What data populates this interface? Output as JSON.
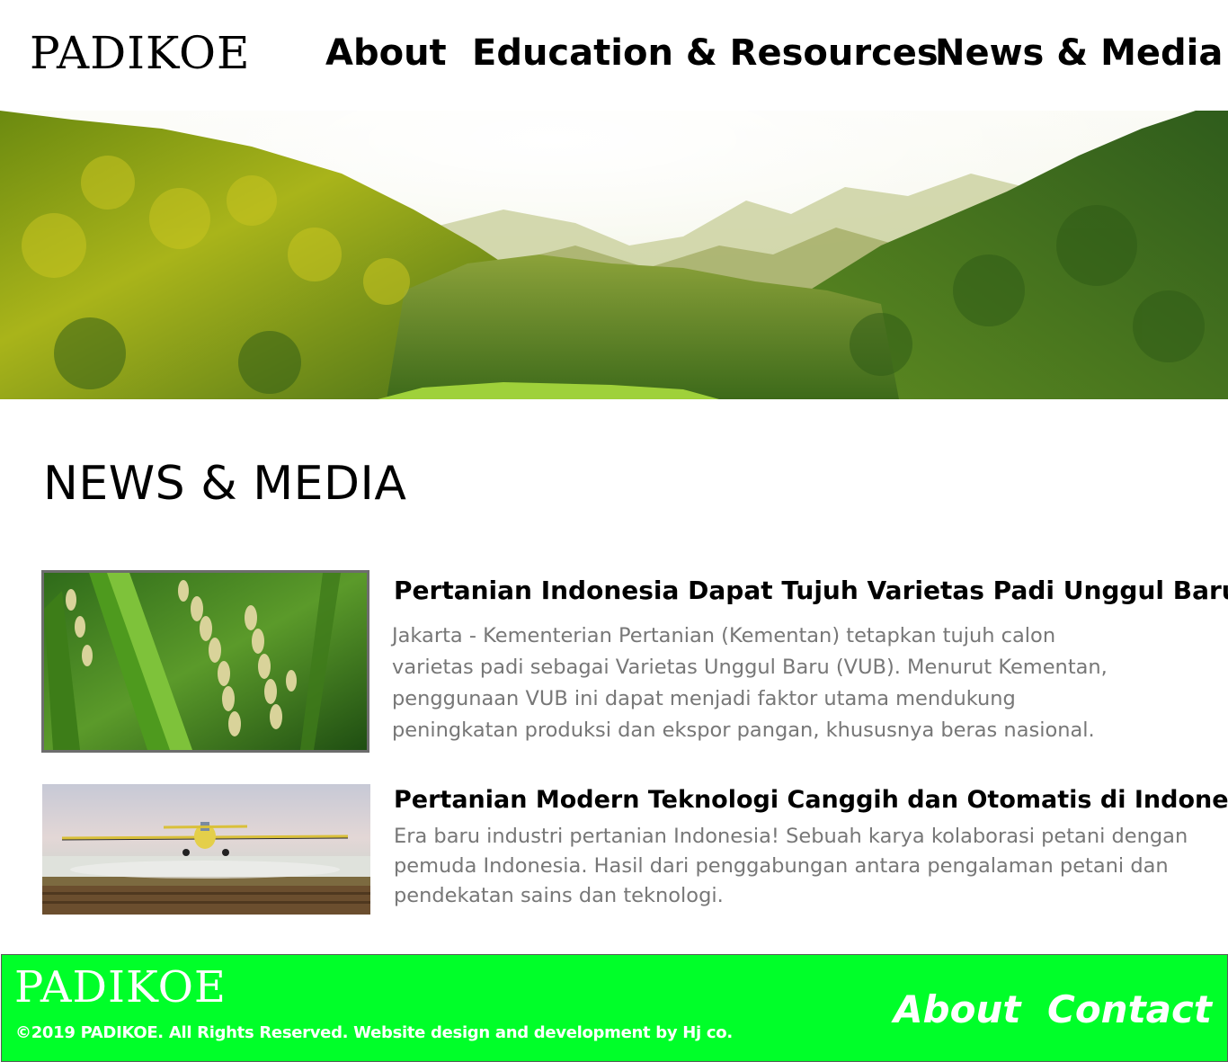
{
  "header": {
    "logo": "PADIKOE",
    "nav": [
      {
        "label": "About"
      },
      {
        "label": "Education & Resources"
      },
      {
        "label": "News & Media"
      }
    ]
  },
  "main": {
    "section_title": "NEWS & MEDIA",
    "articles": [
      {
        "title": "Pertanian Indonesia Dapat Tujuh Varietas Padi Unggul Baru",
        "body_lines": [
          "Jakarta - Kementerian Pertanian (Kementan) tetapkan tujuh calon",
          "varietas padi sebagai Varietas Unggul Baru (VUB). Menurut Kementan,",
          "penggunaan VUB ini dapat menjadi faktor utama mendukung",
          "peningkatan produksi dan ekspor pangan, khususnya beras nasional."
        ]
      },
      {
        "title": "Pertanian Modern Teknologi Canggih dan Otomatis di Indonesia",
        "body_lines": [
          "Era baru industri pertanian Indonesia! Sebuah karya kolaborasi petani dengan",
          "pemuda Indonesia. Hasil dari penggabungan antara pengalaman petani dan",
          "pendekatan sains dan teknologi."
        ]
      }
    ]
  },
  "footer": {
    "logo": "PADIKOE",
    "copyright": "©2019 PADIKOE. All Rights Reserved. Website design and development by Hj co.",
    "links": [
      {
        "label": "About"
      },
      {
        "label": "Contact"
      }
    ],
    "background_color": "#00ff29"
  }
}
